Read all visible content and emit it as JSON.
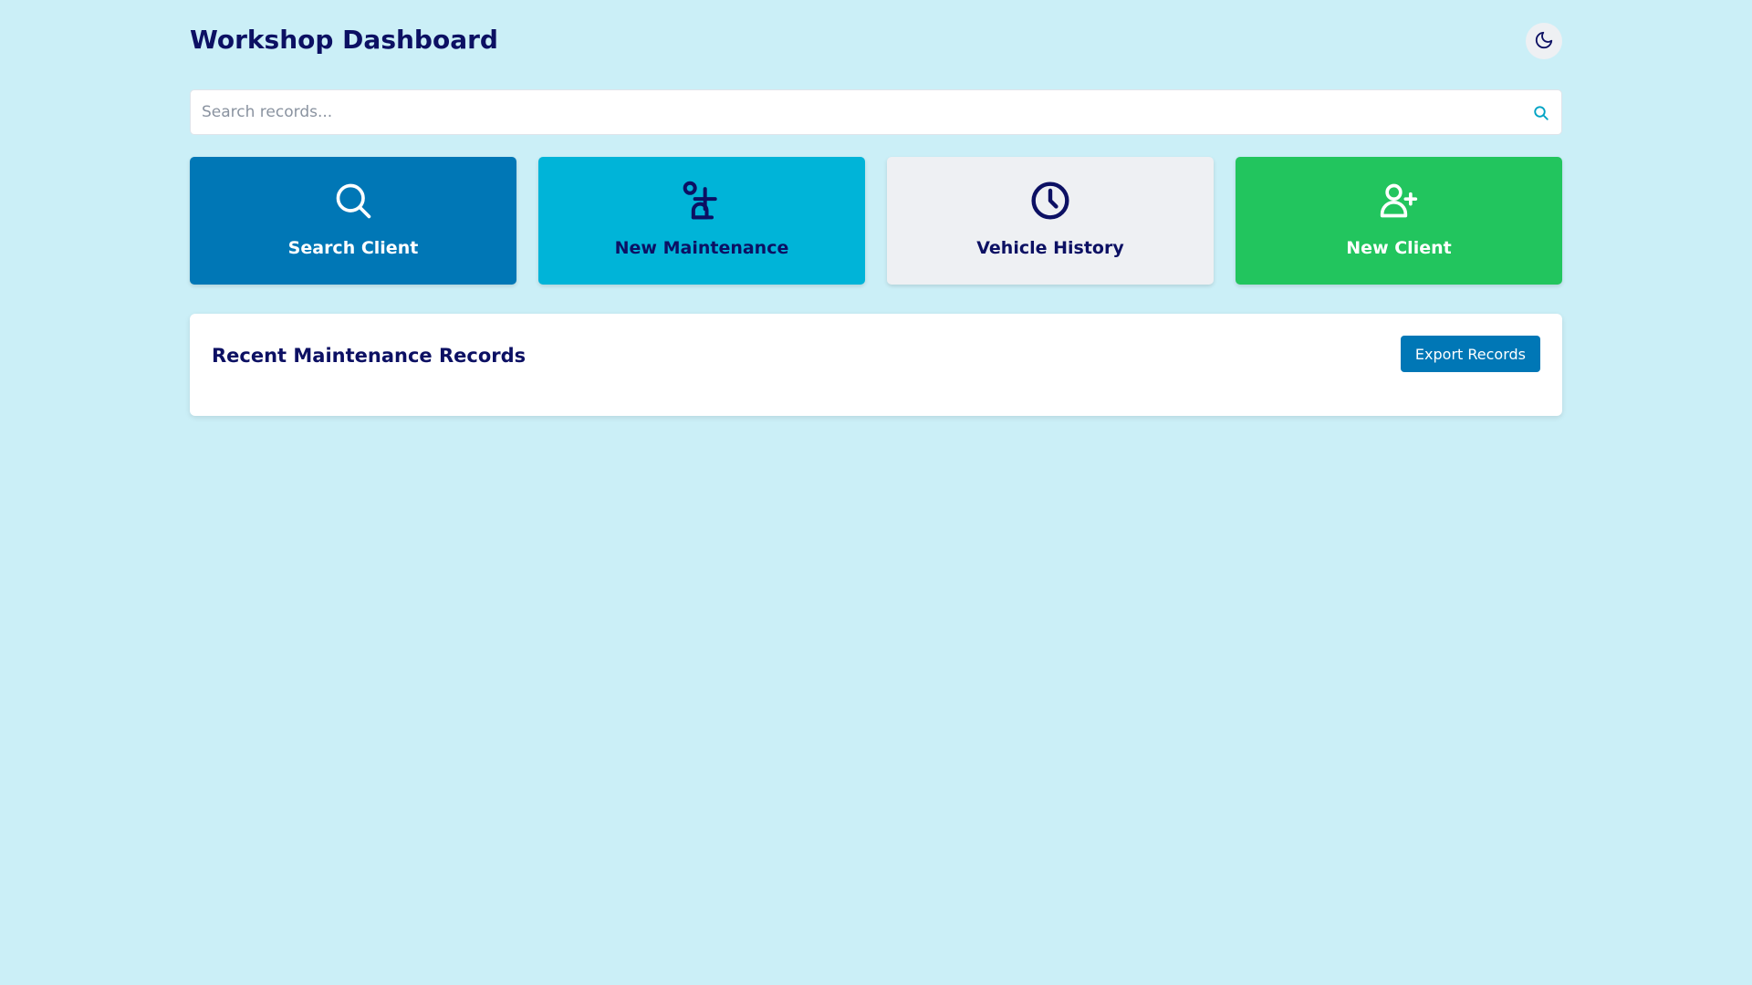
{
  "header": {
    "title": "Workshop Dashboard",
    "theme_toggle_icon": "moon-icon"
  },
  "search": {
    "placeholder": "Search records...",
    "value": "",
    "icon": "search-icon"
  },
  "cards": [
    {
      "label": "Search Client",
      "icon": "search-icon",
      "color": "#0077b6"
    },
    {
      "label": "New Maintenance",
      "icon": "user-plus-icon",
      "color": "#00b4d8"
    },
    {
      "label": "Vehicle History",
      "icon": "clock-icon",
      "color": "#eef0f3"
    },
    {
      "label": "New Client",
      "icon": "user-plus-icon",
      "color": "#22c55e"
    }
  ],
  "records": {
    "title": "Recent Maintenance Records",
    "export_label": "Export Records"
  },
  "colors": {
    "background": "#cbeff7",
    "text": "#0c1063",
    "primary": "#0077b6",
    "cyan": "#00b4d8",
    "green": "#22c55e",
    "light": "#eef0f3"
  }
}
